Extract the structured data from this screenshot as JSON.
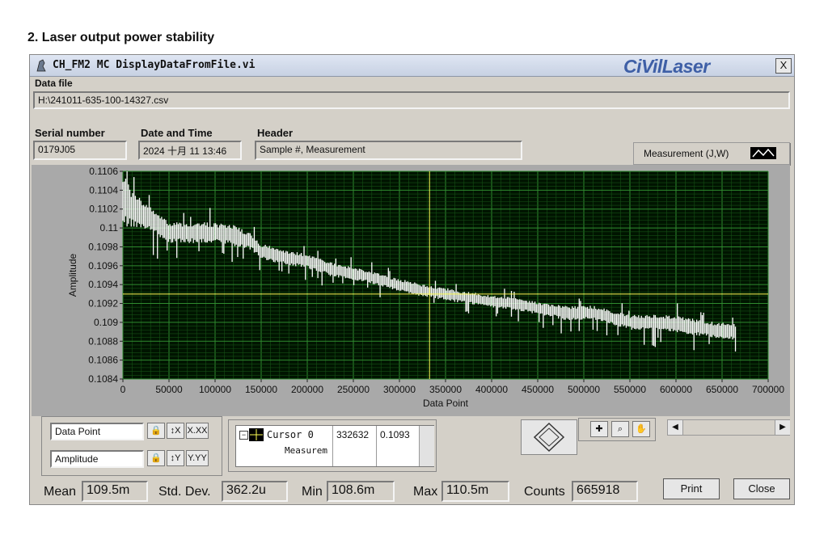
{
  "heading": "2.    Laser output power stability",
  "window": {
    "title": "CH_FM2 MC DisplayDataFromFile.vi",
    "brand": "CiVilLaser",
    "close_label": "X"
  },
  "data_file": {
    "label": "Data file",
    "value": "H:\\241011-635-100-14327.csv"
  },
  "serial": {
    "label": "Serial number",
    "value": "0179J05"
  },
  "datetime": {
    "label": "Date and Time",
    "value": "2024 十月 11 13:46"
  },
  "header": {
    "label": "Header",
    "value": "Sample #, Measurement"
  },
  "legend": {
    "label": "Measurement (J,W)"
  },
  "chart_data": {
    "type": "line",
    "xlabel": "Data Point",
    "ylabel": "Amplitude",
    "xlim": [
      0,
      700000
    ],
    "ylim": [
      0.1084,
      0.1106
    ],
    "x_ticks": [
      "0",
      "50000",
      "100000",
      "150000",
      "200000",
      "250000",
      "300000",
      "350000",
      "400000",
      "450000",
      "500000",
      "550000",
      "600000",
      "650000",
      "700000"
    ],
    "y_ticks": [
      "0.1084",
      "0.1086",
      "0.1088",
      "0.109",
      "0.1092",
      "0.1094",
      "0.1096",
      "0.1098",
      "0.11",
      "0.1102",
      "0.1104",
      "0.1106"
    ],
    "grid": true,
    "background": "#001400",
    "line_color": "#ffffff",
    "cursor_color": "#ffff55",
    "cursor": {
      "x": 332632,
      "y": 0.1093
    },
    "series": [
      {
        "x": [
          0,
          10000,
          30000,
          50000,
          80000,
          100000,
          120000,
          140000,
          150000,
          170000,
          200000,
          230000,
          260000,
          290000,
          320000,
          350000,
          380000,
          420000,
          450000,
          480000,
          510000,
          530000,
          550000,
          580000,
          600000,
          620000,
          640000,
          660000,
          665918
        ],
        "y_mid": [
          0.1103,
          0.1102,
          0.1101,
          0.10995,
          0.10995,
          0.10995,
          0.10992,
          0.10985,
          0.10975,
          0.1097,
          0.10965,
          0.10955,
          0.1095,
          0.10942,
          0.10935,
          0.1093,
          0.10925,
          0.1092,
          0.10915,
          0.1091,
          0.1091,
          0.10905,
          0.109,
          0.109,
          0.10898,
          0.10895,
          0.10892,
          0.1089,
          0.1089
        ],
        "y_spread": [
          0.00025,
          0.00018,
          0.00012,
          0.0001,
          0.0001,
          0.0001,
          0.0001,
          8e-05,
          8e-05,
          7e-05,
          7e-05,
          7e-05,
          6e-05,
          6e-05,
          6e-05,
          6e-05,
          6e-05,
          6e-05,
          6e-05,
          7e-05,
          7e-05,
          7e-05,
          7e-05,
          8e-05,
          8e-05,
          8e-05,
          8e-05,
          8e-05,
          8e-05
        ]
      }
    ]
  },
  "scales": {
    "x_name": "Data Point",
    "y_name": "Amplitude",
    "x_fmt": "X.XX",
    "y_fmt": "Y.YY"
  },
  "cursor_panel": {
    "name": "Cursor 0",
    "x_value": "332632",
    "y_value": "0.1093",
    "sub_label": "Measurem"
  },
  "stats": {
    "mean_label": "Mean",
    "mean_value": "109.5m",
    "std_label": "Std. Dev.",
    "std_value": "362.2u",
    "min_label": "Min",
    "min_value": "108.6m",
    "max_label": "Max",
    "max_value": "110.5m",
    "counts_label": "Counts",
    "counts_value": "665918"
  },
  "buttons": {
    "print": "Print",
    "close": "Close"
  },
  "icons": {
    "app": "labview-app-icon",
    "lock": "lock-icon",
    "zoom": "zoom-icon",
    "hand": "hand-icon",
    "crosshair": "crosshair-icon",
    "nav": "navigation-diamond-icon"
  }
}
